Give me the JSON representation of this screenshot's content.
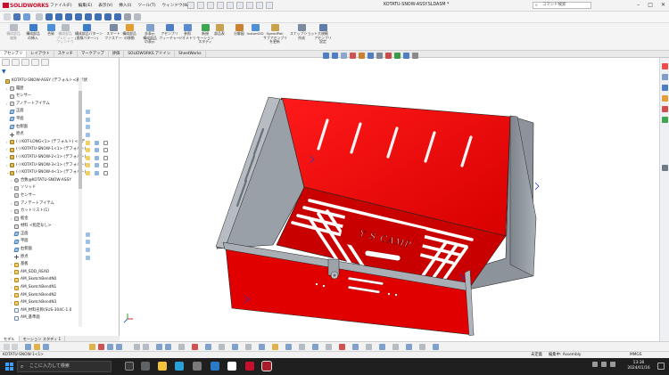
{
  "app": {
    "name": "SOLIDWORKS",
    "menu": [
      "ファイル(F)",
      "編集(E)",
      "表示(V)",
      "挿入(I)",
      "ツール(T)",
      "ウィンドウ(W)"
    ],
    "document_title": "KOTATU-SNOW-ASSY.SLDASM *",
    "search_placeholder": "コマンド検索"
  },
  "command_manager": {
    "items": [
      {
        "label": "構成部品\n編集",
        "enabled": false
      },
      {
        "label": "構成部品\nの挿入",
        "enabled": true
      },
      {
        "label": "合致",
        "enabled": true
      },
      {
        "label": "構成部品\nプレビュー\nウィンドウ",
        "enabled": false
      },
      {
        "label": "構成部品パターン\n(直線パターン)",
        "enabled": true
      },
      {
        "label": "スマート\nファスナー",
        "enabled": true
      },
      {
        "label": "構成部品\nの移動",
        "enabled": true
      },
      {
        "label": "非表示\n構成部品\nの表示",
        "enabled": true
      },
      {
        "label": "アセンブリ\nフィーチャー",
        "enabled": true
      },
      {
        "label": "参照\nジオメトリ",
        "enabled": true
      },
      {
        "label": "新規\nモーション\nスタディ",
        "enabled": true
      },
      {
        "label": "部品表",
        "enabled": true
      },
      {
        "label": "分解図",
        "enabled": true
      },
      {
        "label": "Instant3D",
        "enabled": true
      },
      {
        "label": "SpeedPak\nサブアセンブリ\nを更新",
        "enabled": true
      },
      {
        "label": "スナップショット\n作成",
        "enabled": true
      },
      {
        "label": "大規模\nアセンブリ\n設定",
        "enabled": true
      }
    ]
  },
  "tabs": [
    "アセンブリ",
    "レイアウト",
    "スケッチ",
    "マークアップ",
    "評価",
    "SOLIDWORKS アドイン",
    "SheetWorks"
  ],
  "active_tab": "アセンブリ",
  "tree": {
    "items": [
      {
        "label": "KOTATU-SNOW-ASSY (デフォルト<表示状",
        "icon": "asm",
        "indent": 0,
        "expand": ""
      },
      {
        "label": "履歴",
        "icon": "fold",
        "indent": 1,
        "expand": "›"
      },
      {
        "label": "センサー",
        "icon": "fold",
        "indent": 1,
        "expand": ""
      },
      {
        "label": "アノテートアイテム",
        "icon": "fold",
        "indent": 1,
        "expand": "›"
      },
      {
        "label": "正面",
        "icon": "pl",
        "indent": 1,
        "expand": ""
      },
      {
        "label": "平面",
        "icon": "pl",
        "indent": 1,
        "expand": ""
      },
      {
        "label": "右側面",
        "icon": "pl",
        "indent": 1,
        "expand": ""
      },
      {
        "label": "原点",
        "icon": "org",
        "indent": 1,
        "expand": ""
      },
      {
        "label": "(-) KOT-LONG<1> (デフォルト) <<デ",
        "icon": "asm",
        "indent": 1,
        "expand": "›"
      },
      {
        "label": "(-) KOTATU-SNOW-1<1> (デフォルト)",
        "icon": "asm",
        "indent": 1,
        "expand": "›"
      },
      {
        "label": "(-) KOTATU-SNOW-2<1> (デフォルト)",
        "icon": "asm",
        "indent": 1,
        "expand": "›"
      },
      {
        "label": "(-) KOTATU-SNOW-3<1> (デフォルト)",
        "icon": "asm",
        "indent": 1,
        "expand": "›"
      },
      {
        "label": "(-) KOTATU-SNOW-4<1> (デフォルト)",
        "icon": "asm",
        "indent": 1,
        "expand": "⌄"
      },
      {
        "label": "合致@KOTATU-SNOW-ASSY",
        "icon": "mate",
        "indent": 2,
        "expand": "›"
      },
      {
        "label": "ソリッド",
        "icon": "fold",
        "indent": 2,
        "expand": "›"
      },
      {
        "label": "センサー",
        "icon": "fold",
        "indent": 2,
        "expand": ""
      },
      {
        "label": "アノテートアイテム",
        "icon": "fold",
        "indent": 2,
        "expand": "›"
      },
      {
        "label": "カットリスト(1)",
        "icon": "fold",
        "indent": 2,
        "expand": "›"
      },
      {
        "label": "板金",
        "icon": "fold",
        "indent": 2,
        "expand": "›"
      },
      {
        "label": "材料 <指定なし>",
        "icon": "mat",
        "indent": 2,
        "expand": ""
      },
      {
        "label": "正面",
        "icon": "pl",
        "indent": 2,
        "expand": ""
      },
      {
        "label": "平面",
        "icon": "pl",
        "indent": 2,
        "expand": ""
      },
      {
        "label": "右側面",
        "icon": "pl",
        "indent": 2,
        "expand": ""
      },
      {
        "label": "原点",
        "icon": "org",
        "indent": 2,
        "expand": ""
      },
      {
        "label": "基板",
        "icon": "feat",
        "indent": 2,
        "expand": "›"
      },
      {
        "label": "AM_SDD_READ",
        "icon": "feat",
        "indent": 2,
        "expand": "›"
      },
      {
        "label": "AM_SketchBendN0",
        "icon": "feat",
        "indent": 2,
        "expand": "›"
      },
      {
        "label": "AM_SketchBendN1",
        "icon": "feat",
        "indent": 2,
        "expand": "›"
      },
      {
        "label": "AM_SketchBendN2",
        "icon": "feat",
        "indent": 2,
        "expand": "›"
      },
      {
        "label": "AM_SketchBendN3",
        "icon": "feat",
        "indent": 2,
        "expand": "›"
      },
      {
        "label": "AM_材料名称(SUS-304C-1.0",
        "icon": "sk",
        "indent": 2,
        "expand": ""
      },
      {
        "label": "AM_基準面",
        "icon": "sk",
        "indent": 2,
        "expand": ""
      }
    ]
  },
  "panel_tabs": [
    "モデル",
    "モーション スタディ 1"
  ],
  "model": {
    "engraving": "Y S CAMP",
    "body_color": "#e00000",
    "frame_color": "#9ea3aa"
  },
  "status": {
    "left": "KOTATU-SNOW-1<1>",
    "mid1": "未定義",
    "mid2": "編集中: Assembly",
    "right": "MMGS"
  },
  "taskbar": {
    "search_placeholder": "ここに入力して検索",
    "time": "13:36",
    "date": "2024/01/16"
  }
}
